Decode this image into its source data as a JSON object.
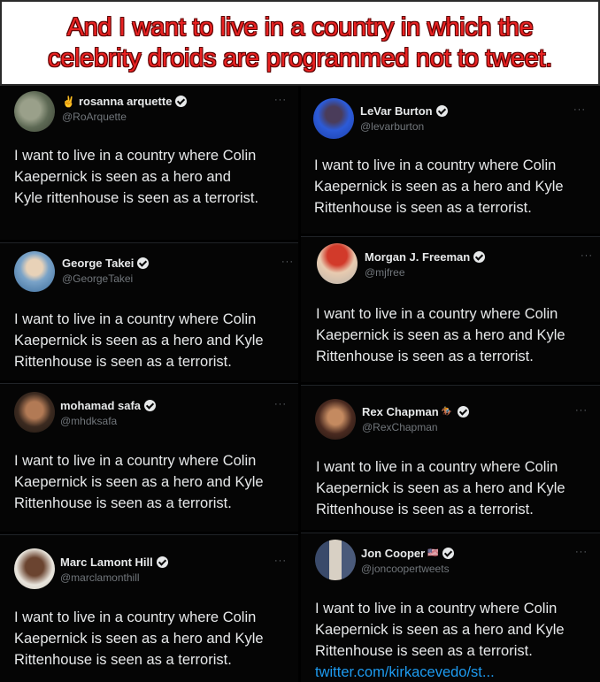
{
  "banner": {
    "line1": "And I want to live in a country in which the",
    "line2": "celebrity droids are programmed not to tweet."
  },
  "more_label": "···",
  "verified_icon": "verified-badge-icon",
  "tweet_text": {
    "line1": "I want to live in a country where Colin",
    "line2": "Kaepernick is seen as a hero and Kyle",
    "line3": "Rittenhouse is seen as a terrorist."
  },
  "tweets": [
    {
      "name": "rosanna arquette",
      "emoji": "✌",
      "handle": "@RoArquette",
      "line1": "I want to live in a country where Colin",
      "line2": "Kaepernick  is seen as a hero and",
      "line3": "Kyle rittenhouse is seen as a terrorist."
    },
    {
      "name": "George Takei",
      "handle": "@GeorgeTakei"
    },
    {
      "name": "mohamad safa",
      "handle": "@mhdksafa"
    },
    {
      "name": "Marc Lamont Hill",
      "handle": "@marclamonthill"
    },
    {
      "name": "LeVar Burton",
      "handle": "@levarburton"
    },
    {
      "name": "Morgan J. Freeman",
      "handle": "@mjfree"
    },
    {
      "name": "Rex Chapman",
      "emoji": "🏇",
      "handle": "@RexChapman"
    },
    {
      "name": "Jon Cooper",
      "emoji": "🇺🇸",
      "handle": "@joncoopertweets",
      "link": "twitter.com/kirkacevedo/st..."
    }
  ],
  "colors": {
    "banner_text": "#e82222",
    "background": "#000000",
    "name": "#e7e9ea",
    "handle": "#71767b",
    "link": "#1d9bf0"
  }
}
